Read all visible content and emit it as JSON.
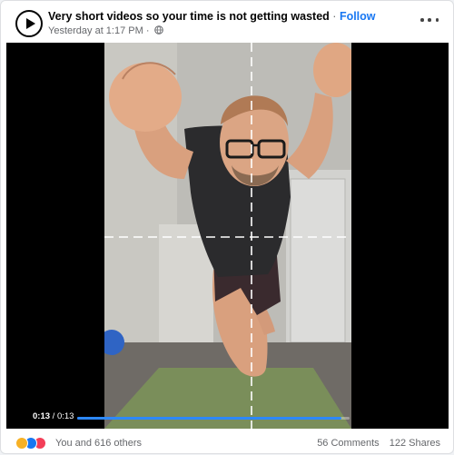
{
  "post": {
    "page_name": "Very short videos so your time is not getting wasted",
    "separator": "·",
    "follow_label": "Follow",
    "timestamp": "Yesterday at 1:17 PM",
    "separator2": "·",
    "privacy_icon": "globe-icon",
    "avatar_icon": "play-icon",
    "more_icon": "more-horizontal-icon"
  },
  "video": {
    "current_time": "0:13",
    "time_separator": "/",
    "duration": "0:13",
    "progress": 0.97
  },
  "footer": {
    "reaction_icons": [
      "haha-icon",
      "like-icon",
      "love-icon"
    ],
    "reactions_text": "You and 616 others",
    "comments": "56 Comments",
    "shares": "122 Shares"
  },
  "colors": {
    "follow": "#1877f2",
    "progress": "#2d88ff",
    "mat": "#7a8e5a"
  }
}
